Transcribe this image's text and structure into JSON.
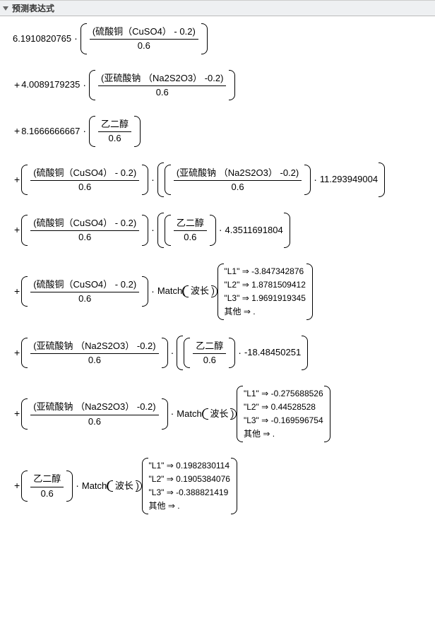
{
  "header": {
    "title": "预测表达式"
  },
  "vars": {
    "cuso4": "硫酸铜（CuSO4）",
    "na2s2o3": "亚硫酸钠 （Na2S2O3）",
    "glycol": "乙二醇",
    "wavelength": "波长",
    "match": "Match",
    "other": "其他",
    "arrow": "⇒"
  },
  "const": {
    "offset": "0.2",
    "neg_offset": "-0.2",
    "scale": "0.6"
  },
  "coef": {
    "c1": "6.1910820765",
    "c2": "4.0089179235",
    "c3": "8.1666666667",
    "c4": "11.293949004",
    "c5": "4.3511691804",
    "c6": "-18.48450251"
  },
  "match1": {
    "L1": "-3.847342876",
    "L2": "1.8781509412",
    "L3": "1.9691919345"
  },
  "match2": {
    "L1": "-0.275688526",
    "L2": "0.44528528",
    "L3": "-0.169596754"
  },
  "match3": {
    "L1": "0.1982830114",
    "L2": "0.1905384076",
    "L3": "-0.388821419"
  },
  "labels": {
    "L1": "\"L1\"",
    "L2": "\"L2\"",
    "L3": "\"L3\""
  }
}
